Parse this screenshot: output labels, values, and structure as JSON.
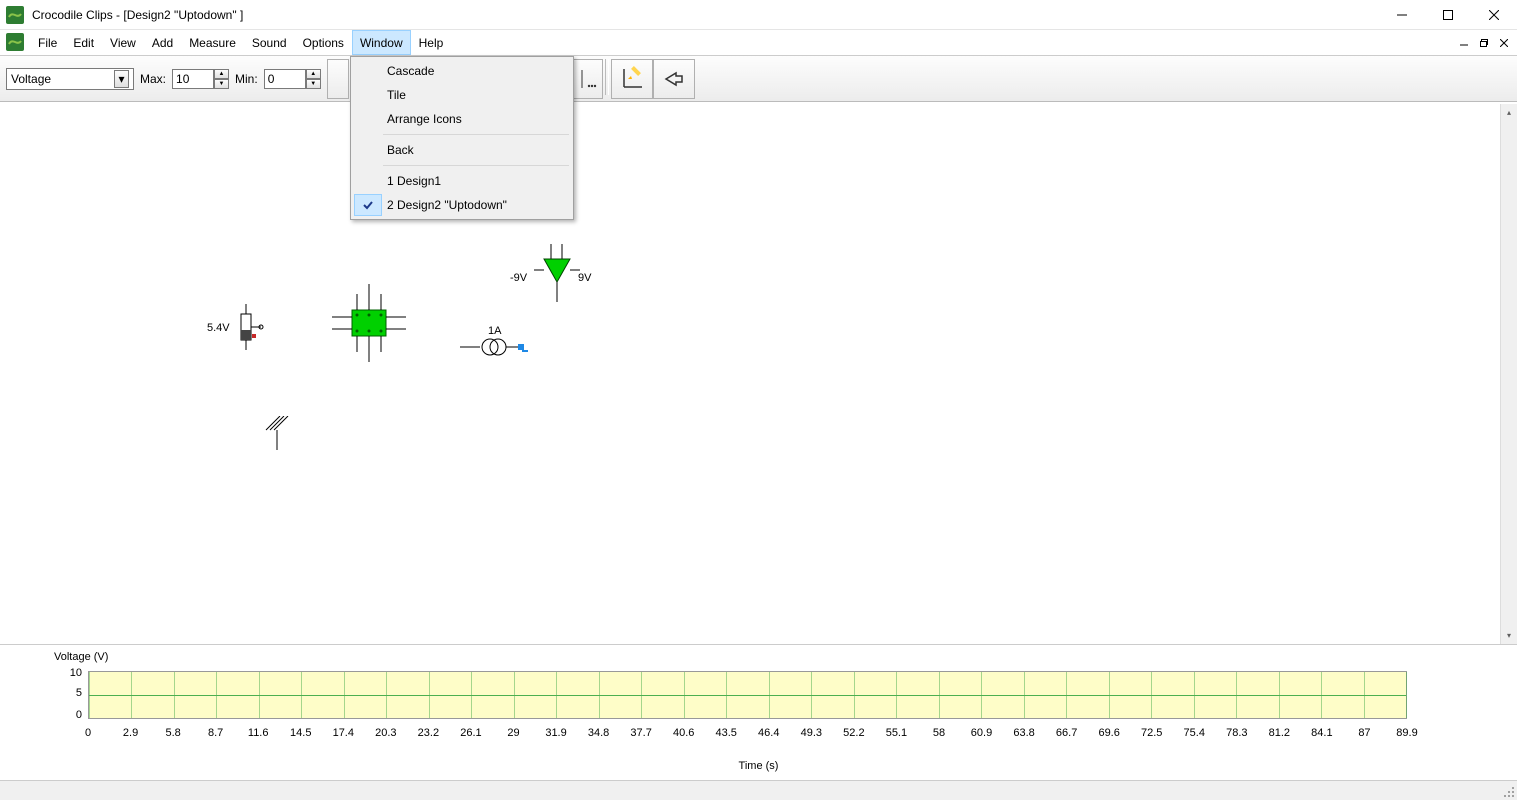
{
  "titlebar": {
    "title": "Crocodile Clips - [Design2 \"Uptodown\" ]"
  },
  "menubar": {
    "file": "File",
    "edit": "Edit",
    "view": "View",
    "add": "Add",
    "measure": "Measure",
    "sound": "Sound",
    "options": "Options",
    "window": "Window",
    "help": "Help"
  },
  "window_menu": {
    "cascade": "Cascade",
    "tile": "Tile",
    "arrange": "Arrange Icons",
    "back": "Back",
    "design1": "1 Design1",
    "design2": "2 Design2 \"Uptodown\""
  },
  "toolbar": {
    "selector": "Voltage",
    "max_label": "Max:",
    "max_value": "10",
    "min_label": "Min:",
    "min_value": "0"
  },
  "canvas": {
    "pot_label": "5.4V",
    "current_label": "1A",
    "tri_left": "-9V",
    "tri_right": "9V"
  },
  "chart_data": {
    "type": "line",
    "title": "Voltage (V)",
    "xlabel": "Time (s)",
    "ylabel": "",
    "ylim": [
      0,
      10
    ],
    "yticks": [
      0,
      5,
      10
    ],
    "xticks": [
      0,
      2.9,
      5.8,
      8.7,
      11.6,
      14.5,
      17.4,
      20.3,
      23.2,
      26.1,
      29,
      31.9,
      34.8,
      37.7,
      40.6,
      43.5,
      46.4,
      49.3,
      52.2,
      55.1,
      58,
      60.9,
      63.8,
      66.7,
      69.6,
      72.5,
      75.4,
      78.3,
      81.2,
      84.1,
      87,
      89.9
    ],
    "series": []
  }
}
